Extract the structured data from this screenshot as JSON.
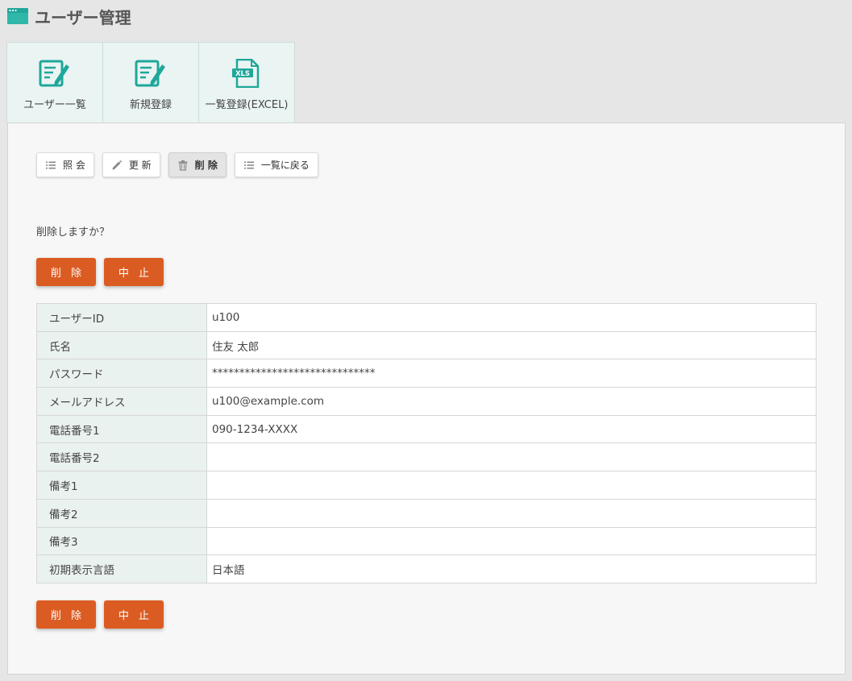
{
  "page": {
    "title": "ユーザー管理"
  },
  "tabs": [
    {
      "label": "ユーザー一覧",
      "icon": "edit-document-icon"
    },
    {
      "label": "新規登録",
      "icon": "edit-document-icon"
    },
    {
      "label": "一覧登録(EXCEL)",
      "icon": "xls-file-icon",
      "icon_text": "XLS"
    }
  ],
  "toolbar": {
    "view": "照 会",
    "update": "更 新",
    "delete": "削 除",
    "back": "一覧に戻る"
  },
  "message": "削除しますか？",
  "actions": {
    "delete": "削 除",
    "cancel": "中 止"
  },
  "table": {
    "rows": [
      {
        "label": "ユーザーID",
        "value": "u100"
      },
      {
        "label": "氏名",
        "value": "住友 太郎"
      },
      {
        "label": "パスワード",
        "value": "******************************"
      },
      {
        "label": "メールアドレス",
        "value": "u100@example.com"
      },
      {
        "label": "電話番号1",
        "value": "090-1234-XXXX"
      },
      {
        "label": "電話番号2",
        "value": ""
      },
      {
        "label": "備考1",
        "value": ""
      },
      {
        "label": "備考2",
        "value": ""
      },
      {
        "label": "備考3",
        "value": ""
      },
      {
        "label": "初期表示言語",
        "value": "日本語"
      }
    ]
  },
  "colors": {
    "accent_teal": "#1fa79a",
    "action_orange": "#db5c22",
    "label_cell_bg": "#eaf2f0"
  }
}
